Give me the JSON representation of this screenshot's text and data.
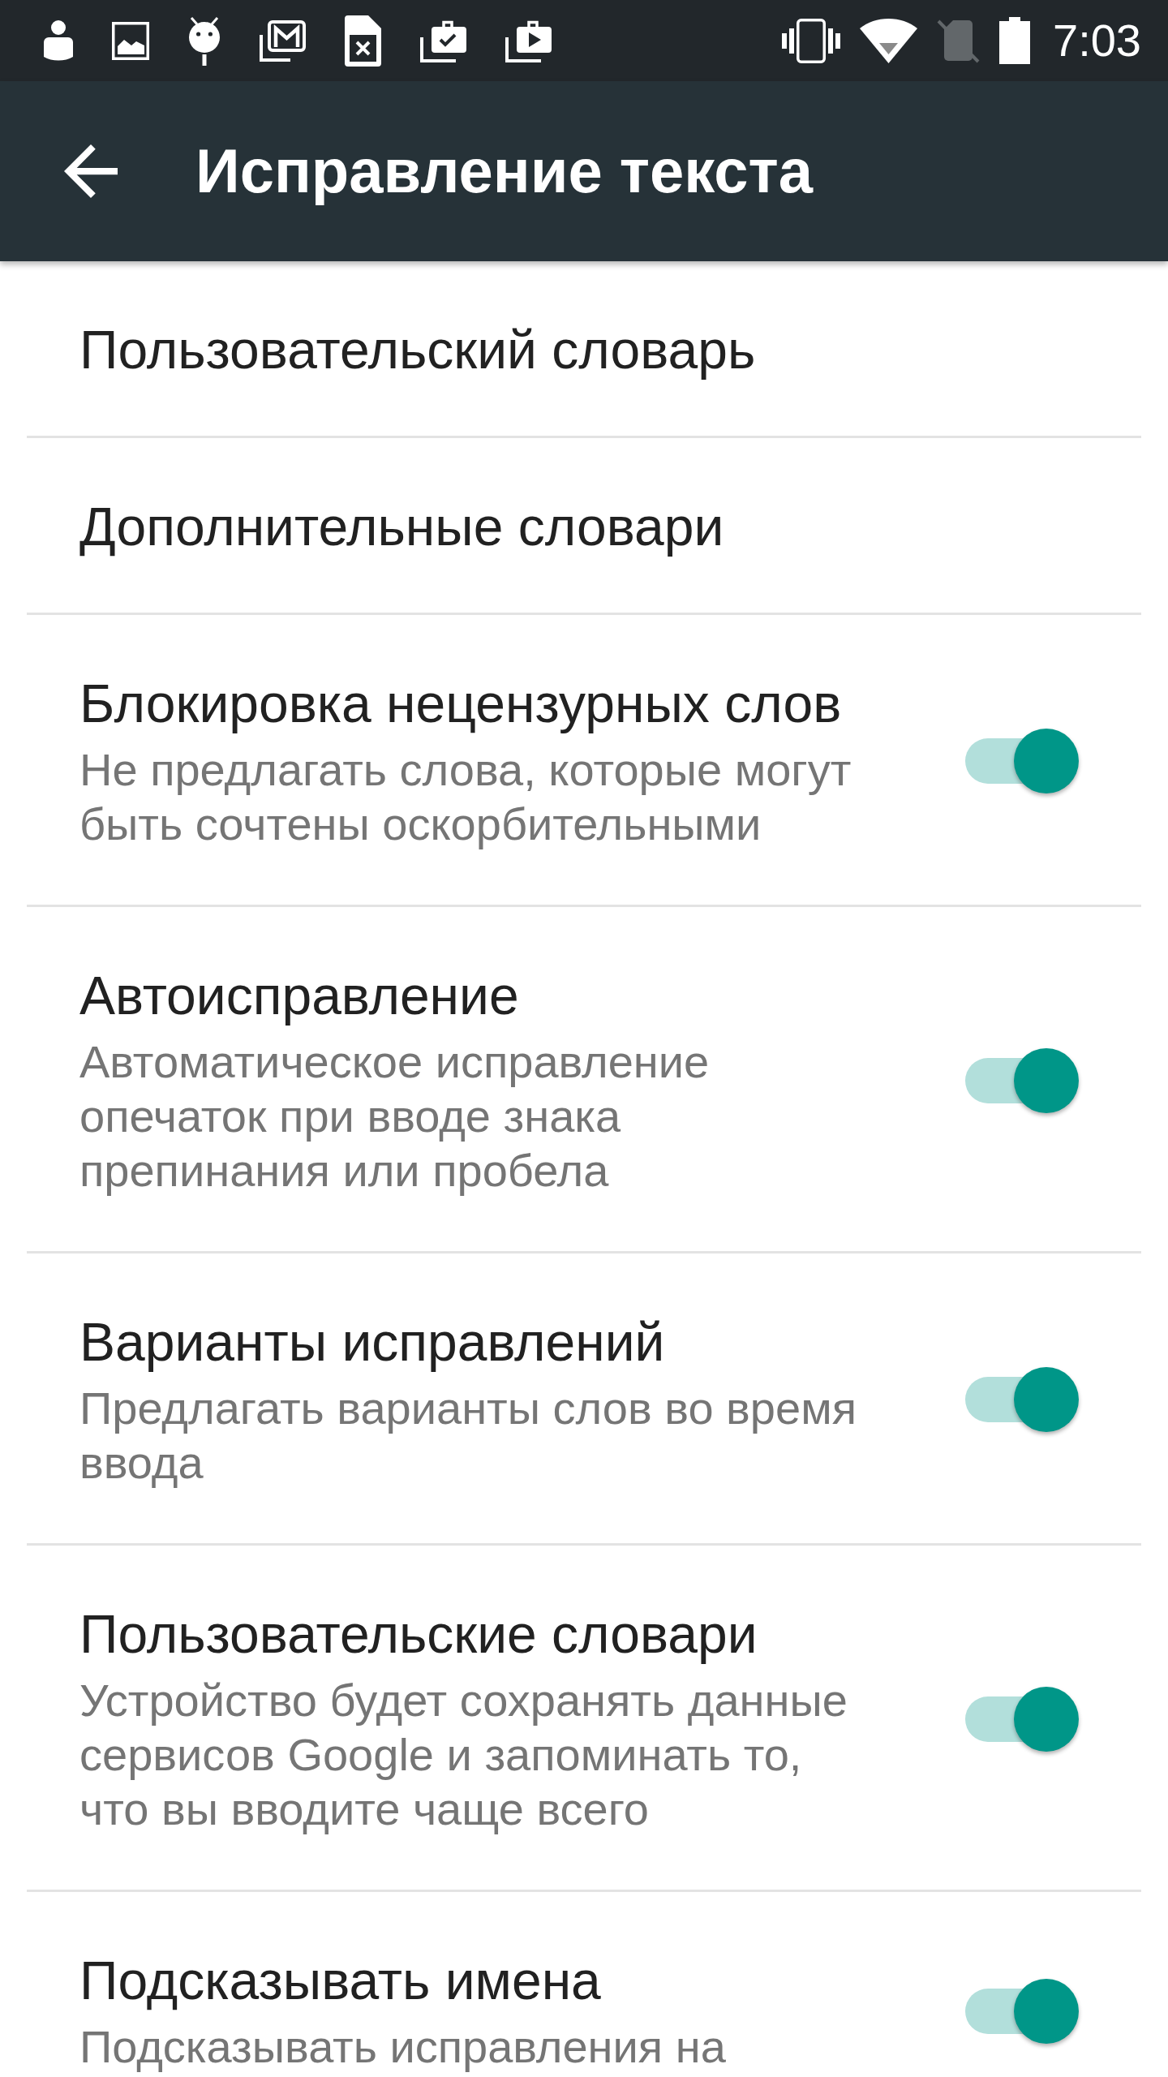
{
  "status_bar": {
    "time": "7:03"
  },
  "app_bar": {
    "title": "Исправление текста"
  },
  "settings": [
    {
      "kind": "link",
      "title": "Пользовательский словарь"
    },
    {
      "kind": "link",
      "title": "Дополнительные словари"
    },
    {
      "kind": "switch",
      "title": "Блокировка нецензурных слов",
      "summary": "Не предлагать слова, которые могут быть сочтены оскорбительными",
      "on": true
    },
    {
      "kind": "switch",
      "title": "Автоисправление",
      "summary": "Автоматическое исправление опечаток при вводе знака препинания или пробела",
      "on": true
    },
    {
      "kind": "switch",
      "title": "Варианты исправлений",
      "summary": "Предлагать варианты слов во время ввода",
      "on": true
    },
    {
      "kind": "switch",
      "title": "Пользовательские словари",
      "summary": "Устройство будет сохранять данные сервисов Google и запоминать то, что вы вводите чаще всего",
      "on": true
    },
    {
      "kind": "switch",
      "title": "Подсказывать имена",
      "summary": "Подсказывать исправления на",
      "on": true
    }
  ]
}
